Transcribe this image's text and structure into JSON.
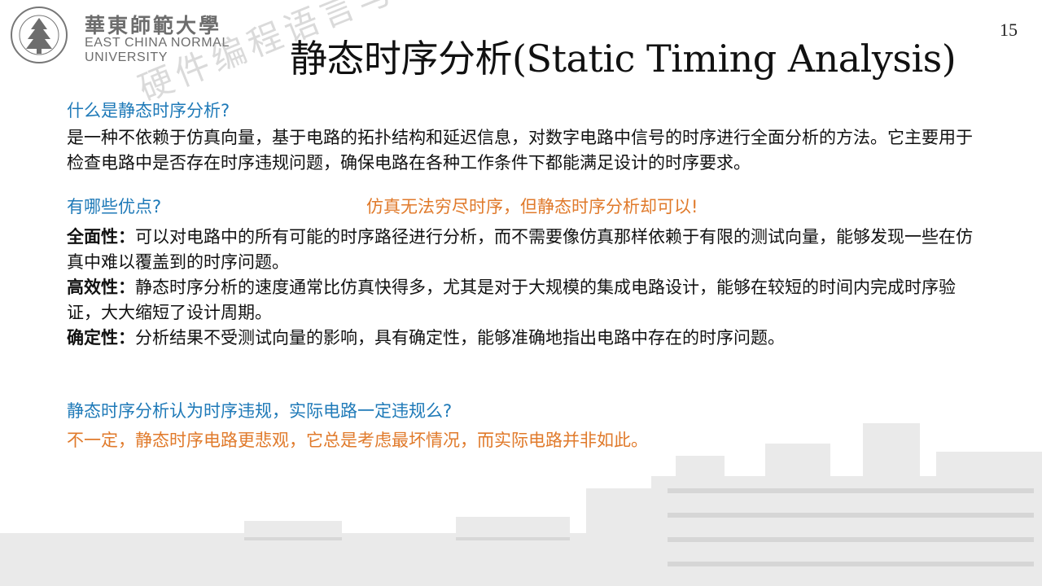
{
  "logo": {
    "chinese_name": "華東師範大學",
    "english_line1": "EAST CHINA NORMAL",
    "english_line2": "UNIVERSITY"
  },
  "page_number": "15",
  "title": "静态时序分析(Static Timing Analysis)",
  "sections": {
    "q1": "什么是静态时序分析?",
    "a1": "是一种不依赖于仿真向量，基于电路的拓扑结构和延迟信息，对数字电路中信号的时序进行全面分析的方法。它主要用于检查电路中是否存在时序违规问题，确保电路在各种工作条件下都能满足设计的时序要求。",
    "q2": "有哪些优点?",
    "q2_note": "仿真无法穷尽时序，但静态时序分析却可以!",
    "advantages": [
      {
        "term": "全面性：",
        "text": "可以对电路中的所有可能的时序路径进行分析，而不需要像仿真那样依赖于有限的测试向量，能够发现一些在仿真中难以覆盖到的时序问题。"
      },
      {
        "term": "高效性：",
        "text": "静态时序分析的速度通常比仿真快得多，尤其是对于大规模的集成电路设计，能够在较短的时间内完成时序验证，大大缩短了设计周期。"
      },
      {
        "term": "确定性：",
        "text": "分析结果不受测试向量的影响，具有确定性，能够准确地指出电路中存在的时序问题。"
      }
    ],
    "q3": "静态时序分析认为时序违规，实际电路一定违规么?",
    "a3": "不一定，静态时序电路更悲观，它总是考虑最坏情况，而实际电路并非如此。"
  },
  "watermark": "硬件编程语言与数字集成电路设计 华东师范大学 李磊",
  "colors": {
    "question_blue": "#1f7ab8",
    "highlight_orange": "#e07a2b",
    "text": "#111111",
    "logo_gray": "#6d6d6d"
  }
}
